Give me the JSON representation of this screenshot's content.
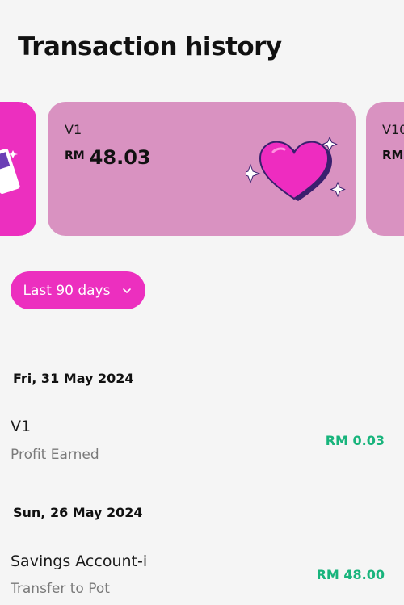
{
  "header": {
    "title": "Transaction history"
  },
  "carousel": {
    "main_card": {
      "name": "V1",
      "currency": "RM",
      "amount": "48.03",
      "color": "#d992c1"
    },
    "right_card": {
      "name": "V10",
      "currency": "RM",
      "color": "#d992c1"
    },
    "left_card": {
      "color": "#ec2fbf"
    }
  },
  "filter": {
    "label": "Last 90 days",
    "icon": "chevron-down-icon"
  },
  "groups": [
    {
      "date": "Fri, 31 May 2024",
      "items": [
        {
          "title": "V1",
          "subtitle": "Profit Earned",
          "amount": "RM 0.03"
        }
      ]
    },
    {
      "date": "Sun, 26 May 2024",
      "items": [
        {
          "title": "Savings Account-i",
          "subtitle": "Transfer to Pot",
          "amount": "RM 48.00"
        }
      ]
    }
  ],
  "colors": {
    "accent": "#ec2fbf",
    "positive": "#18b47c",
    "background": "#f5f5f5"
  }
}
